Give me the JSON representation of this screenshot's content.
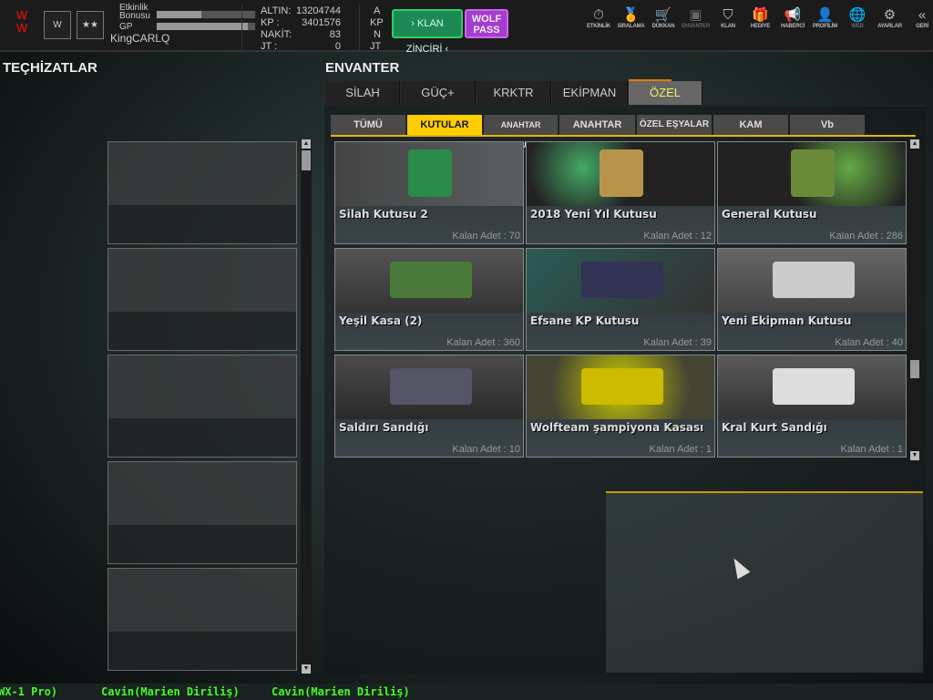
{
  "player": {
    "etkinlik_label": "Etkinlik",
    "bonus_label": "Bonusu",
    "gp_label": "GP",
    "name": "KingCARLQ",
    "logo_text": "WOLF",
    "bonus_fill": 0.45,
    "gp_fill": 0.93
  },
  "currency": [
    {
      "key": "ALTIN:",
      "value": "13204744",
      "unit": "A"
    },
    {
      "key": "KP :",
      "value": "3401576",
      "unit": "KP"
    },
    {
      "key": "NAKİT:",
      "value": "83",
      "unit": "N"
    },
    {
      "key": "JT :",
      "value": "0",
      "unit": "JT"
    }
  ],
  "buttons": {
    "klan": "› KLAN ZİNCİRİ ‹",
    "wolf1": "WOLF",
    "wolf2": "PASS"
  },
  "nav": [
    {
      "label": "ETKİNLİK",
      "icon": "⏱"
    },
    {
      "label": "SIRALAMA",
      "icon": "🏅"
    },
    {
      "label": "DÜKKAN",
      "icon": "🛒"
    },
    {
      "label": "ENVANTER",
      "icon": "▣"
    },
    {
      "label": "KLAN",
      "icon": "⛉"
    },
    {
      "label": "HEDİYE",
      "icon": "🎁"
    },
    {
      "label": "HABERCİ",
      "icon": "📢"
    },
    {
      "label": "PROFİLİM",
      "icon": "👤"
    },
    {
      "label": "WEB",
      "icon": "🌐"
    },
    {
      "label": "AYARLAR",
      "icon": "⚙"
    },
    {
      "label": "GERİ",
      "icon": "«"
    }
  ],
  "left_title": "TEÇHİZATLAR",
  "inventory_title": "ENVANTER",
  "tabs": [
    "SİLAH",
    "GÜÇ+",
    "KRKTR",
    "EKİPMAN",
    "ÖZEL"
  ],
  "subtabs": [
    "TÜMÜ",
    "KUTULAR",
    "ANAHTAR KUTUSU",
    "ANAHTAR",
    "ÖZEL EŞYALAR",
    "KAM",
    "Vb"
  ],
  "items": [
    {
      "name": "Silah Kutusu 2",
      "count": "Kalan Adet : 70"
    },
    {
      "name": "2018 Yeni Yıl Kutusu",
      "count": "Kalan Adet : 12"
    },
    {
      "name": "General Kutusu",
      "count": "Kalan Adet : 286"
    },
    {
      "name": "Yeşil Kasa (2)",
      "count": "Kalan Adet : 360"
    },
    {
      "name": "Efsane KP Kutusu",
      "count": "Kalan Adet : 39"
    },
    {
      "name": "Yeni Ekipman Kutusu",
      "count": "Kalan Adet : 40"
    },
    {
      "name": "Saldırı Sandığı",
      "count": "Kalan Adet : 10"
    },
    {
      "name": "Wolfteam şampiyona Kasası",
      "count": "Kalan Adet : 1"
    },
    {
      "name": "Kral Kurt Sandığı",
      "count": "Kalan Adet : 1"
    }
  ],
  "chat": [
    "WX-1 Pro)",
    "Cavin(Marien Diriliş)",
    "Cavin(Marien Diriliş)"
  ]
}
